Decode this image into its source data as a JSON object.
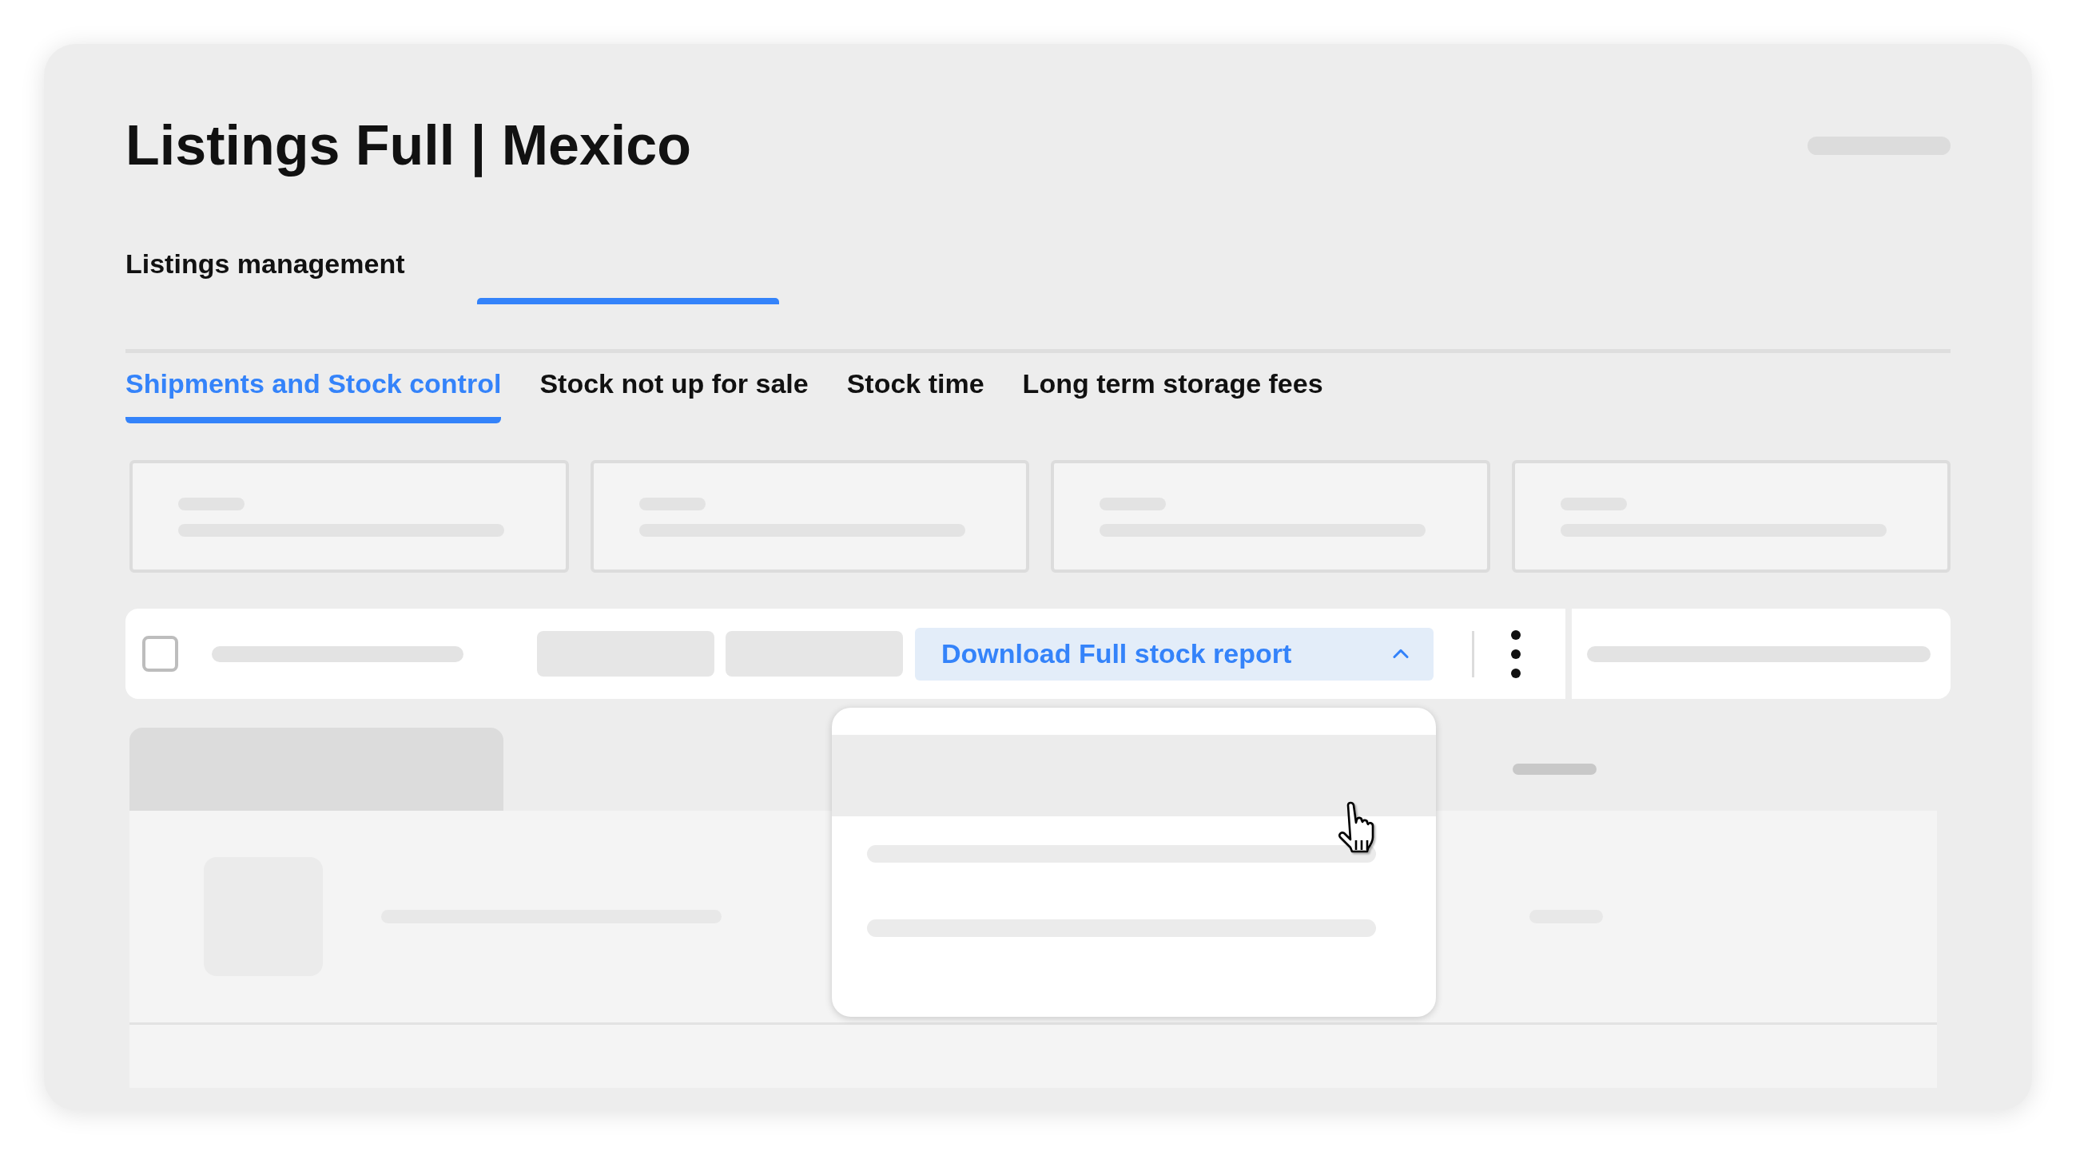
{
  "title": "Listings Full | Mexico",
  "nav": {
    "label": "Listings management"
  },
  "tabs": [
    {
      "label": "Shipments and Stock control",
      "selected": true
    },
    {
      "label": "Stock not up for sale",
      "selected": false
    },
    {
      "label": "Stock time",
      "selected": false
    },
    {
      "label": "Long term storage fees",
      "selected": false
    }
  ],
  "toolbar": {
    "checkbox": {
      "checked": false
    },
    "download_button": {
      "label": "Download Full stock report",
      "expanded": true
    }
  },
  "dropdown": {
    "items": [
      {
        "kind": "blank",
        "selected": true
      },
      {
        "kind": "line",
        "selected": false
      },
      {
        "kind": "line",
        "selected": false
      }
    ]
  }
}
